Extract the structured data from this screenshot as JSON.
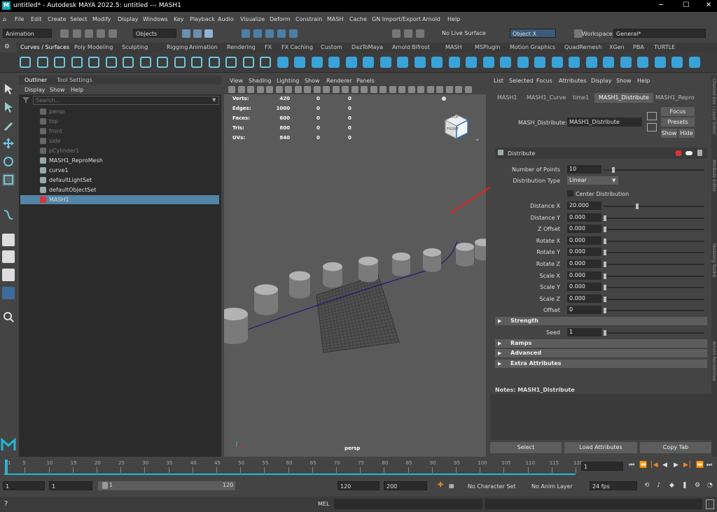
{
  "title_bar": {
    "logo": "M",
    "text": "untitled* - Autodesk MAYA 2022.5: untitled   ---   MASH1"
  },
  "menus": [
    "File",
    "Edit",
    "Create",
    "Select",
    "Modify",
    "Display",
    "Windows",
    "Key",
    "Playback",
    "Audio",
    "Visualize",
    "Deform",
    "Constrain",
    "MASH",
    "Cache",
    "GN Import/Export",
    "Arnold",
    "Help"
  ],
  "status_line": {
    "mode": "Animation",
    "objects": "Objects",
    "live_surface": "No Live Surface",
    "object_field": "Object X",
    "workspace_label": "Workspace :",
    "workspace_value": "General*"
  },
  "shelf_tabs": [
    "Curves / Surfaces",
    "Poly Modeling",
    "Sculpting",
    "Rigging",
    "Animation",
    "Rendering",
    "FX",
    "FX Caching",
    "Custom",
    "DazToMaya",
    "Arnold",
    "Bifrost",
    "MASH",
    "MSPlugin",
    "Motion Graphics",
    "QuadRemesh",
    "XGen",
    "PBA",
    "TURTLE"
  ],
  "outliner": {
    "tabs": [
      "Outliner",
      "Tool Settings"
    ],
    "menu": [
      "Display",
      "Show",
      "Help"
    ],
    "search_placeholder": "Search...",
    "items": [
      {
        "label": "persp",
        "dim": true
      },
      {
        "label": "top",
        "dim": true
      },
      {
        "label": "front",
        "dim": true
      },
      {
        "label": "side",
        "dim": true
      },
      {
        "label": "pCylinder1",
        "dim": true
      },
      {
        "label": "MASH1_ReproMesh",
        "dim": false
      },
      {
        "label": "curve1",
        "dim": false
      },
      {
        "label": "defaultLightSet",
        "dim": false
      },
      {
        "label": "defaultObjectSet",
        "dim": false
      },
      {
        "label": "MASH1",
        "dim": false,
        "selected": true
      }
    ]
  },
  "viewport": {
    "menu": [
      "View",
      "Shading",
      "Lighting",
      "Show",
      "Renderer",
      "Panels"
    ],
    "hud": [
      {
        "label": "Verts:",
        "a": "420",
        "b": "0",
        "c": "0"
      },
      {
        "label": "Edges:",
        "a": "1000",
        "b": "0",
        "c": "0"
      },
      {
        "label": "Faces:",
        "a": "600",
        "b": "0",
        "c": "0"
      },
      {
        "label": "Tris:",
        "a": "800",
        "b": "0",
        "c": "0"
      },
      {
        "label": "UVs:",
        "a": "840",
        "b": "0",
        "c": "0"
      }
    ],
    "camera_label": "persp",
    "viewcube_top": "TOP",
    "viewcube_front": "FRONT"
  },
  "attribute_editor": {
    "menu": [
      "List",
      "Selected",
      "Focus",
      "Attributes",
      "Display",
      "Show",
      "Help"
    ],
    "tabs": [
      "MASH1",
      "MASH1_Curve",
      "time1",
      "MASH1_Distribute",
      "MASH1_Repro"
    ],
    "node_label": "MASH_Distribute:",
    "node_value": "MASH1_Distribute",
    "buttons": {
      "focus": "Focus",
      "presets": "Presets",
      "show": "Show",
      "hide": "Hide"
    },
    "distribute_header": "Distribute",
    "number_of_points": {
      "label": "Number of Points",
      "value": "10"
    },
    "distribution_type": {
      "label": "Distribution Type",
      "value": "Linear"
    },
    "center_distribution": "Center Distribution",
    "fields": [
      {
        "label": "Distance X",
        "value": "20.000",
        "slider": 0.32
      },
      {
        "label": "Distance Y",
        "value": "0.000",
        "slider": 0
      },
      {
        "label": "Z Offset",
        "value": "0.000",
        "slider": 0
      },
      {
        "label": "Rotate X",
        "value": "0.000",
        "slider": 0
      },
      {
        "label": "Rotate Y",
        "value": "0.000",
        "slider": 0
      },
      {
        "label": "Rotate Z",
        "value": "0.000",
        "slider": 0
      },
      {
        "label": "Scale X",
        "value": "0.000",
        "slider": 0
      },
      {
        "label": "Scale Y",
        "value": "0.000",
        "slider": 0
      },
      {
        "label": "Scale Z",
        "value": "0.000",
        "slider": 0
      },
      {
        "label": "Offset",
        "value": "0",
        "slider": 0
      }
    ],
    "strength_header": "Strength",
    "seed": {
      "label": "Seed",
      "value": "1"
    },
    "sections": [
      "Ramps",
      "Advanced",
      "Extra Attributes"
    ],
    "notes_label": "Notes:  MASH1_Distribute",
    "bottom_buttons": [
      "Select",
      "Load Attributes",
      "Copy Tab"
    ]
  },
  "time_slider": {
    "ticks": [
      "1",
      "5",
      "10",
      "15",
      "20",
      "25",
      "30",
      "35",
      "40",
      "45",
      "50",
      "55",
      "60",
      "65",
      "70",
      "75",
      "80",
      "85",
      "90",
      "95",
      "100",
      "105",
      "110",
      "115",
      "120"
    ],
    "current_frame": "1"
  },
  "range_slider": {
    "start": "1",
    "playback_start": "1",
    "range_start": "1",
    "range_end": "120",
    "playback_end": "120",
    "end": "200",
    "character_set": "No Character Set",
    "anim_layer": "No Anim Layer",
    "fps": "24 fps"
  },
  "command_line": {
    "label": "MEL"
  },
  "side_strip_labels": [
    "Channel Box / Layer Editor",
    "Attribute Editor",
    "Modeling Toolkit",
    "Arnold RenderView"
  ]
}
